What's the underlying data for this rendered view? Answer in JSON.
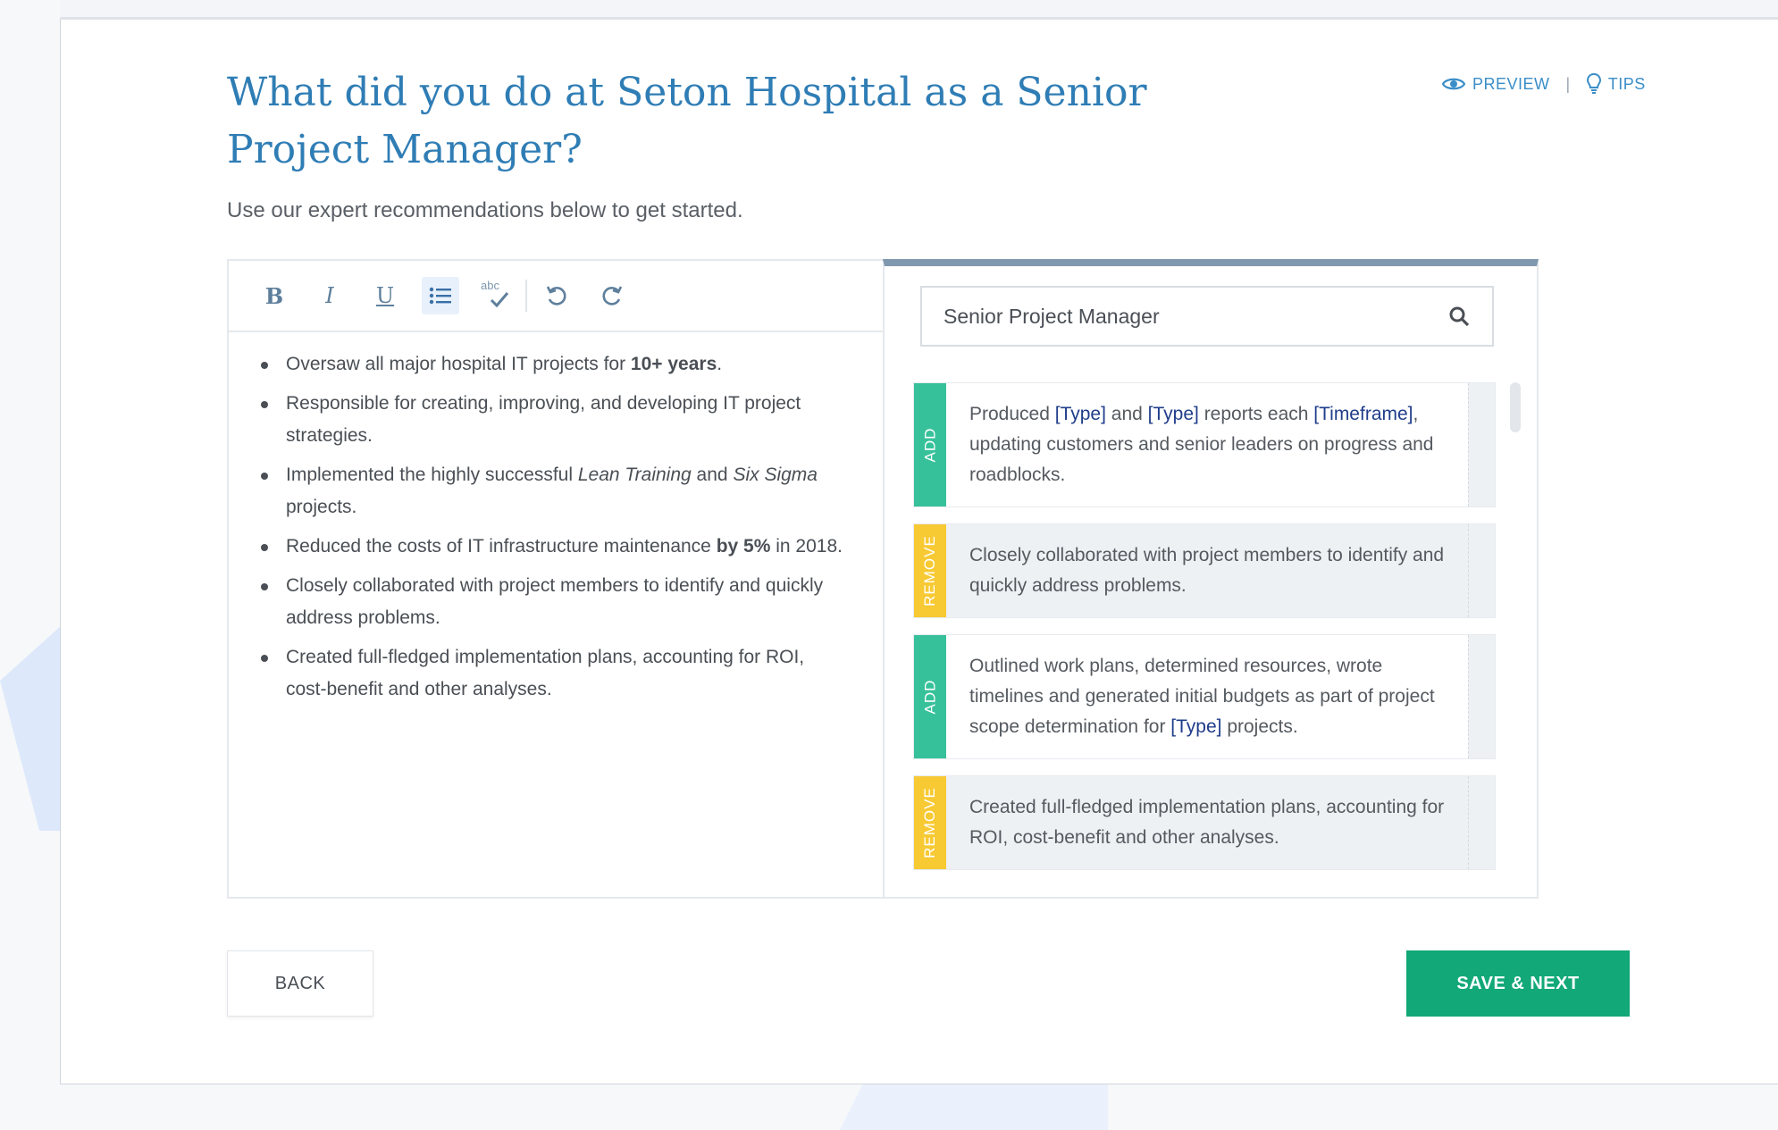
{
  "header": {
    "title": "What did you do at Seton Hospital as a Senior Project Manager?",
    "subtitle": "Use our expert recommendations below to get started.",
    "preview_label": "PREVIEW",
    "separator": "|",
    "tips_label": "TIPS"
  },
  "toolbar": {
    "bold": "B",
    "italic": "I",
    "underline": "U",
    "spellcheck_label": "abc"
  },
  "editor": {
    "bullets": [
      {
        "parts": [
          {
            "t": "Oversaw all major hospital IT projects for "
          },
          {
            "t": "10+ years",
            "b": true
          },
          {
            "t": "."
          }
        ]
      },
      {
        "parts": [
          {
            "t": "Responsible for creating, improving, and developing IT project strategies."
          }
        ]
      },
      {
        "parts": [
          {
            "t": "Implemented the highly successful "
          },
          {
            "t": "Lean Training",
            "i": true
          },
          {
            "t": " and "
          },
          {
            "t": "Six Sigma",
            "i": true
          },
          {
            "t": " projects."
          }
        ]
      },
      {
        "parts": [
          {
            "t": "Reduced the costs of IT infrastructure maintenance "
          },
          {
            "t": "by 5%",
            "b": true
          },
          {
            "t": " in 2018."
          }
        ]
      },
      {
        "parts": [
          {
            "t": "Closely collaborated with project members to identify and quickly address problems."
          }
        ]
      },
      {
        "parts": [
          {
            "t": "Created full-fledged implementation plans, accounting for ROI, cost-benefit and other analyses."
          }
        ]
      }
    ]
  },
  "search": {
    "value": "Senior Project Manager"
  },
  "suggestions": [
    {
      "tag": "ADD",
      "kind": "add",
      "parts": [
        {
          "t": "Produced "
        },
        {
          "t": "[Type]",
          "ph": true
        },
        {
          "t": " and "
        },
        {
          "t": "[Type]",
          "ph": true
        },
        {
          "t": " reports each "
        },
        {
          "t": "[Timeframe]",
          "ph": true
        },
        {
          "t": ", updating customers and senior leaders on progress and roadblocks."
        }
      ]
    },
    {
      "tag": "REMOVE",
      "kind": "remove",
      "parts": [
        {
          "t": "Closely collaborated with project members to identify and quickly address problems."
        }
      ]
    },
    {
      "tag": "ADD",
      "kind": "add",
      "parts": [
        {
          "t": "Outlined work plans, determined resources, wrote timelines and generated initial budgets as part of project scope determination for "
        },
        {
          "t": "[Type]",
          "ph": true
        },
        {
          "t": " projects."
        }
      ]
    },
    {
      "tag": "REMOVE",
      "kind": "remove",
      "parts": [
        {
          "t": "Created full-fledged implementation plans, accounting for ROI, cost-benefit and other analyses."
        }
      ]
    }
  ],
  "footer": {
    "back_label": "BACK",
    "next_label": "SAVE & NEXT"
  },
  "colors": {
    "title": "#2f7db5",
    "add_tag": "#37c19a",
    "remove_tag": "#f7c933",
    "primary_button": "#12a877",
    "placeholder_text": "#1f3d8a"
  },
  "icons": [
    "eye-icon",
    "lightbulb-icon",
    "bold-icon",
    "italic-icon",
    "underline-icon",
    "bullet-list-icon",
    "spellcheck-icon",
    "undo-icon",
    "redo-icon",
    "search-icon"
  ]
}
